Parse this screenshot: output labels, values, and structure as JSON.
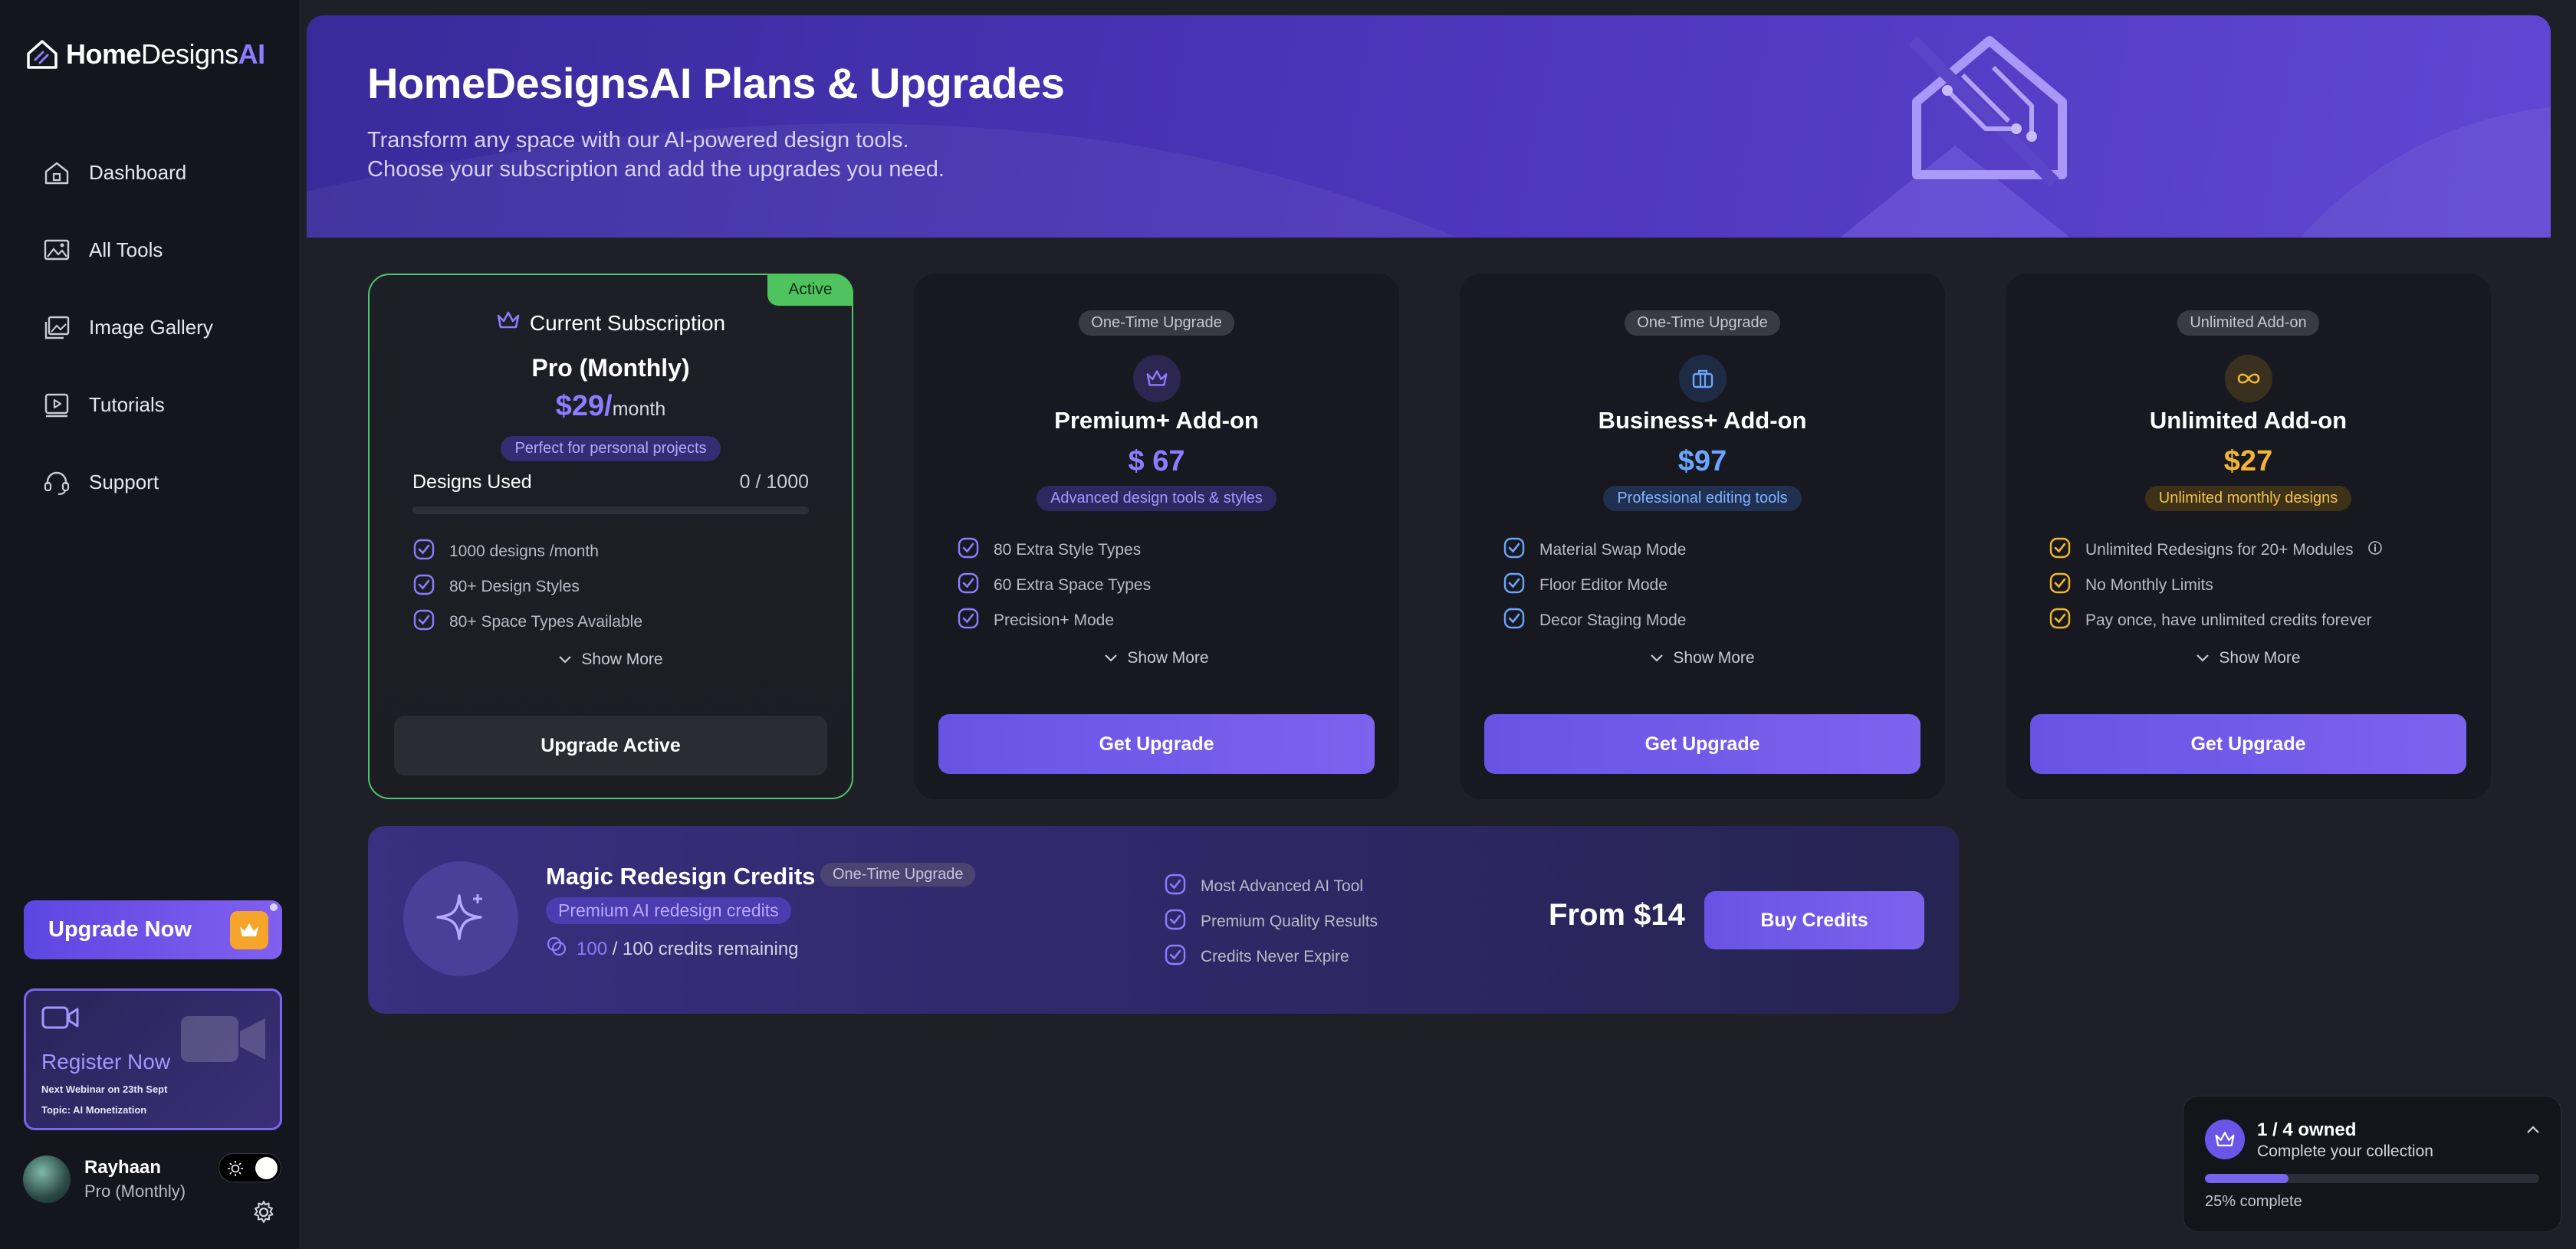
{
  "brand": {
    "part1": "Home",
    "part2": "Designs",
    "part3": "AI"
  },
  "sidebar": {
    "items": [
      {
        "label": "Dashboard",
        "icon": "home-icon"
      },
      {
        "label": "All Tools",
        "icon": "image-tools-icon"
      },
      {
        "label": "Image Gallery",
        "icon": "gallery-icon"
      },
      {
        "label": "Tutorials",
        "icon": "play-icon"
      },
      {
        "label": "Support",
        "icon": "headset-icon"
      }
    ],
    "upgrade_label": "Upgrade Now",
    "webinar": {
      "title": "Register Now",
      "line1": "Next Webinar on 23th Sept",
      "line2": "Topic: AI Monetization"
    },
    "user": {
      "name": "Rayhaan",
      "plan": "Pro (Monthly)"
    }
  },
  "hero": {
    "title": "HomeDesignsAI Plans & Upgrades",
    "subtitle1": "Transform any space with our AI-powered design tools.",
    "subtitle2": "Choose your subscription and add the upgrades you need."
  },
  "current": {
    "active_tag": "Active",
    "header": "Current Subscription",
    "name": "Pro (Monthly)",
    "price": "$29/",
    "period": "month",
    "tag": "Perfect for personal projects",
    "usage_label": "Designs Used",
    "usage_value": "0 / 1000",
    "usage_fraction": 0,
    "features": [
      "1000 designs /month",
      "80+ Design Styles",
      "80+ Space Types Available"
    ],
    "show_more": "Show More",
    "button": "Upgrade Active"
  },
  "addons": [
    {
      "badge": "One-Time Upgrade",
      "icon": "crown-icon",
      "name": "Premium+ Add-on",
      "price": "$ 67",
      "tag": "Advanced design tools & styles",
      "features": [
        "80 Extra Style Types",
        "60 Extra Space Types",
        "Precision+ Mode"
      ],
      "show_more": "Show More",
      "button": "Get Upgrade",
      "accent": "#8f7bff"
    },
    {
      "badge": "One-Time Upgrade",
      "icon": "briefcase-icon",
      "name": "Business+ Add-on",
      "price": "$97",
      "tag": "Professional editing tools",
      "features": [
        "Material Swap Mode",
        "Floor Editor Mode",
        "Decor Staging Mode"
      ],
      "show_more": "Show More",
      "button": "Get Upgrade",
      "accent": "#6aa6ff"
    },
    {
      "badge": "Unlimited Add-on",
      "icon": "infinity-icon",
      "name": "Unlimited Add-on",
      "price": "$27",
      "tag": "Unlimited monthly designs",
      "features": [
        "Unlimited Redesigns for 20+ Modules",
        "No Monthly Limits",
        "Pay once, have unlimited credits forever"
      ],
      "show_more": "Show More",
      "button": "Get Upgrade",
      "accent": "#f2b631"
    }
  ],
  "credits": {
    "title": "Magic Redesign Credits",
    "badge": "One-Time Upgrade",
    "pill": "Premium AI redesign credits",
    "remaining_num": "100",
    "remaining_text": "/ 100 credits remaining",
    "features": [
      "Most Advanced AI Tool",
      "Premium Quality Results",
      "Credits Never Expire"
    ],
    "price": "From $14",
    "button": "Buy Credits"
  },
  "collection": {
    "owned": "1 / 4 owned",
    "subtitle": "Complete your collection",
    "progress": 0.25,
    "percent_label": "25% complete"
  }
}
